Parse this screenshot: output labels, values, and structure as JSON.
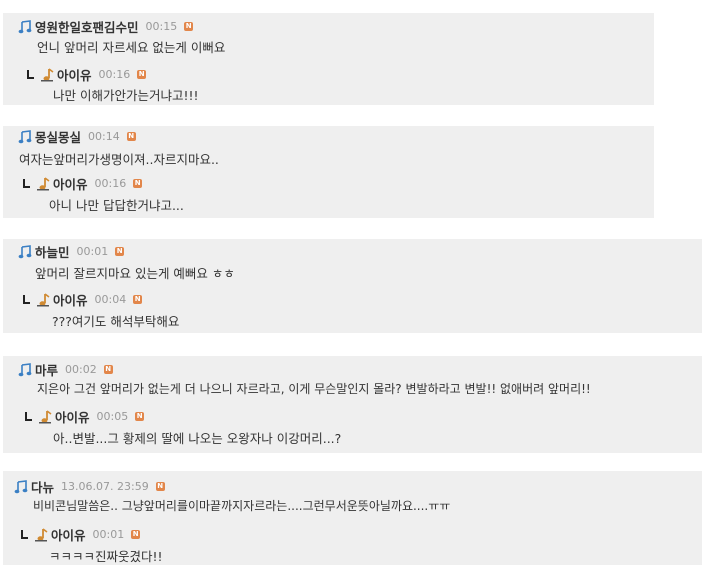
{
  "comments": [
    {
      "author": "영원한일호팬김수민",
      "time": "00:15",
      "text": "언니 앞머리 자르세요 없는게 이뻐요",
      "reply": {
        "author": "아이유",
        "time": "00:16",
        "text": "나만 이해가안가는거냐고!!!"
      }
    },
    {
      "author": "몽실몽실",
      "time": "00:14",
      "text": "여자는앞머리가생명이져..자르지마요..",
      "reply": {
        "author": "아이유",
        "time": "00:16",
        "text": "아니 나만 답답한거냐고..."
      }
    },
    {
      "author": "하늘민",
      "time": "00:01",
      "text": "앞머리 잘르지마요 있는게 예뻐요 ㅎㅎ",
      "reply": {
        "author": "아이유",
        "time": "00:04",
        "text": "???여기도 해석부탁해요"
      }
    },
    {
      "author": "마루",
      "time": "00:02",
      "text": "지은아 그건 앞머리가 없는게 더 나으니 자르라고, 이게 무슨말인지 몰라? 변발하라고 변발!! 없애버려 앞머리!!",
      "reply": {
        "author": "아이유",
        "time": "00:05",
        "text": "아..변발...그 황제의 딸에 나오는 오왕자나 이강머리...?"
      }
    },
    {
      "author": "다뉴",
      "time": "13.06.07. 23:59",
      "text": "비비콘님말씀은.. 그냥앞머리를이마끝까지자르라는....그런무서운뜻아닐까요....ㅠㅠ",
      "reply": {
        "author": "아이유",
        "time": "00:01",
        "text": "ㅋㅋㅋㅋ진짜웃겼다!!"
      }
    }
  ],
  "icons": {
    "member": "music-note-icon",
    "reply_author": "artist-badge-icon",
    "new": "new-badge-icon",
    "reply": "reply-arrow-icon"
  },
  "colors": {
    "block_bg": "#efefef",
    "new_badge": "#e2864a",
    "member_icon": "#3a7fc4",
    "artist_icon": "#d08a32"
  },
  "badge_text": "N"
}
